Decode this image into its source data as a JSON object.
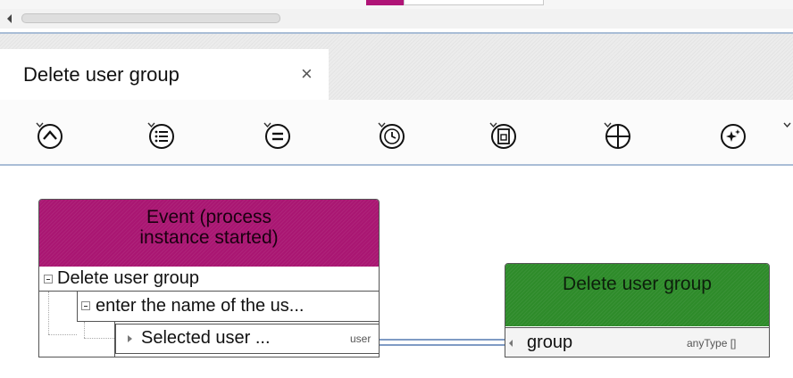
{
  "document_tab": {
    "title": "Delete user group",
    "close_glyph": "×"
  },
  "toolbar": {
    "tools": [
      {
        "icon": "up-circle-icon"
      },
      {
        "icon": "list-circle-icon"
      },
      {
        "icon": "equals-circle-icon"
      },
      {
        "icon": "clock-circle-icon"
      },
      {
        "icon": "document-icon"
      },
      {
        "icon": "plus-circle-icon"
      },
      {
        "icon": "sparkle-circle-icon"
      }
    ]
  },
  "event_node": {
    "header_line1": "Event (process",
    "header_line2": "instance started)",
    "tree": {
      "level1": "Delete user group",
      "level2": "enter the name of the us...",
      "level3": "Selected user ...",
      "level3_tag": "user"
    },
    "color": "#a91672"
  },
  "task_node": {
    "title": "Delete user group",
    "port_label": "group",
    "port_type": "anyType []",
    "color": "#2e8b2a"
  },
  "connector_color": "#7f9bc4"
}
